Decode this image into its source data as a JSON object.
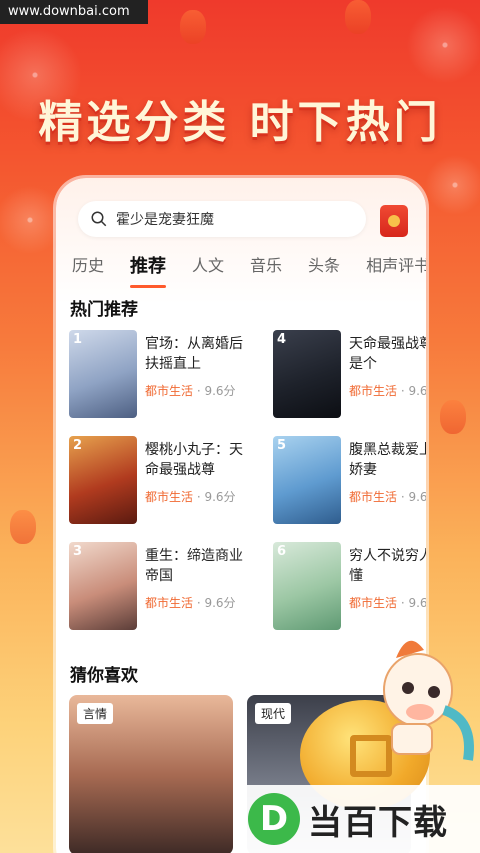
{
  "watermark": "www.downbai.com",
  "headline": "精选分类  时下热门",
  "search": {
    "text": "霍少是宠妻狂魔"
  },
  "tabs": [
    {
      "label": "历史",
      "active": false
    },
    {
      "label": "推荐",
      "active": true
    },
    {
      "label": "人文",
      "active": false
    },
    {
      "label": "音乐",
      "active": false
    },
    {
      "label": "头条",
      "active": false
    },
    {
      "label": "相声评书",
      "active": false
    }
  ],
  "hot": {
    "title": "热门推荐",
    "items": [
      {
        "rank": "1",
        "title_l1": "官场：从离婚后",
        "title_l2": "扶摇直上",
        "genre": "都市生活",
        "score": "· 9.6分"
      },
      {
        "rank": "2",
        "title_l1": "樱桃小丸子：天",
        "title_l2": "命最强战尊",
        "genre": "都市生活",
        "score": "· 9.6分"
      },
      {
        "rank": "3",
        "title_l1": "重生：缔造商业",
        "title_l2": "帝国",
        "genre": "都市生活",
        "score": "· 9.6分"
      },
      {
        "rank": "4",
        "title_l1": "天命最强战尊",
        "title_l2": "是个",
        "genre": "都市生活",
        "score": "· 9.6"
      },
      {
        "rank": "5",
        "title_l1": "腹黑总裁爱上",
        "title_l2": "娇妻",
        "genre": "都市生活",
        "score": "· 9.6"
      },
      {
        "rank": "6",
        "title_l1": "穷人不说穷人",
        "title_l2": "懂",
        "genre": "都市生活",
        "score": "· 9.6"
      }
    ]
  },
  "like": {
    "title": "猜你喜欢",
    "cards": [
      {
        "tag": "言情"
      },
      {
        "tag": "现代"
      }
    ]
  },
  "logo": {
    "letter": "D",
    "text": "当百下载"
  }
}
